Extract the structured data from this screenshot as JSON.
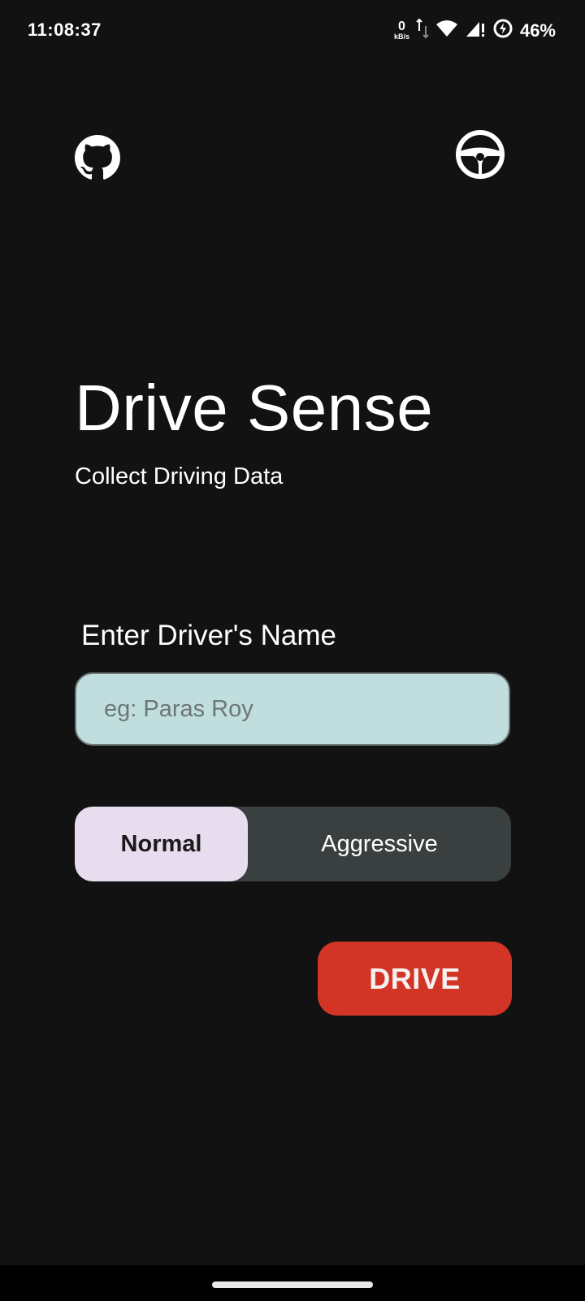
{
  "status_bar": {
    "time": "11:08:37",
    "net_speed_value": "0",
    "net_speed_unit": "kB/s",
    "battery_percent": "46%"
  },
  "header": {
    "left_icon": "github-icon",
    "right_icon": "steering-wheel-icon"
  },
  "app": {
    "title": "Drive Sense",
    "subtitle": "Collect Driving Data"
  },
  "form": {
    "label": "Enter Driver's Name",
    "name_value": "",
    "name_placeholder": "eg: Paras Roy"
  },
  "mode_toggle": {
    "options": [
      "Normal",
      "Aggressive"
    ],
    "selected": "Normal"
  },
  "actions": {
    "drive_label": "DRIVE"
  },
  "colors": {
    "background": "#121212",
    "input_bg": "#c1dedf",
    "toggle_active": "#e7ddef",
    "toggle_track": "#3a4040",
    "drive_button": "#d23526"
  }
}
